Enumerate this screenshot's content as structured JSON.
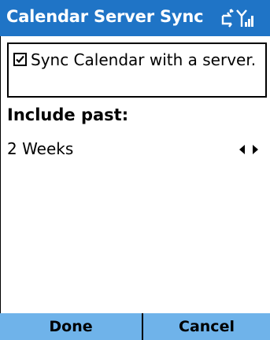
{
  "window": {
    "title": "Calendar Server Sync"
  },
  "status": {
    "icons": [
      "sync-icon",
      "signal-strength-icon"
    ]
  },
  "sync_checkbox": {
    "label": "Sync Calendar with a server.",
    "checked": true
  },
  "include_past": {
    "label": "Include past:",
    "value": "2 Weeks"
  },
  "softkeys": {
    "left": "Done",
    "right": "Cancel"
  },
  "colors": {
    "title_bar": "#1f74c6",
    "softkey_bar": "#6fb3ea",
    "text": "#000000"
  }
}
